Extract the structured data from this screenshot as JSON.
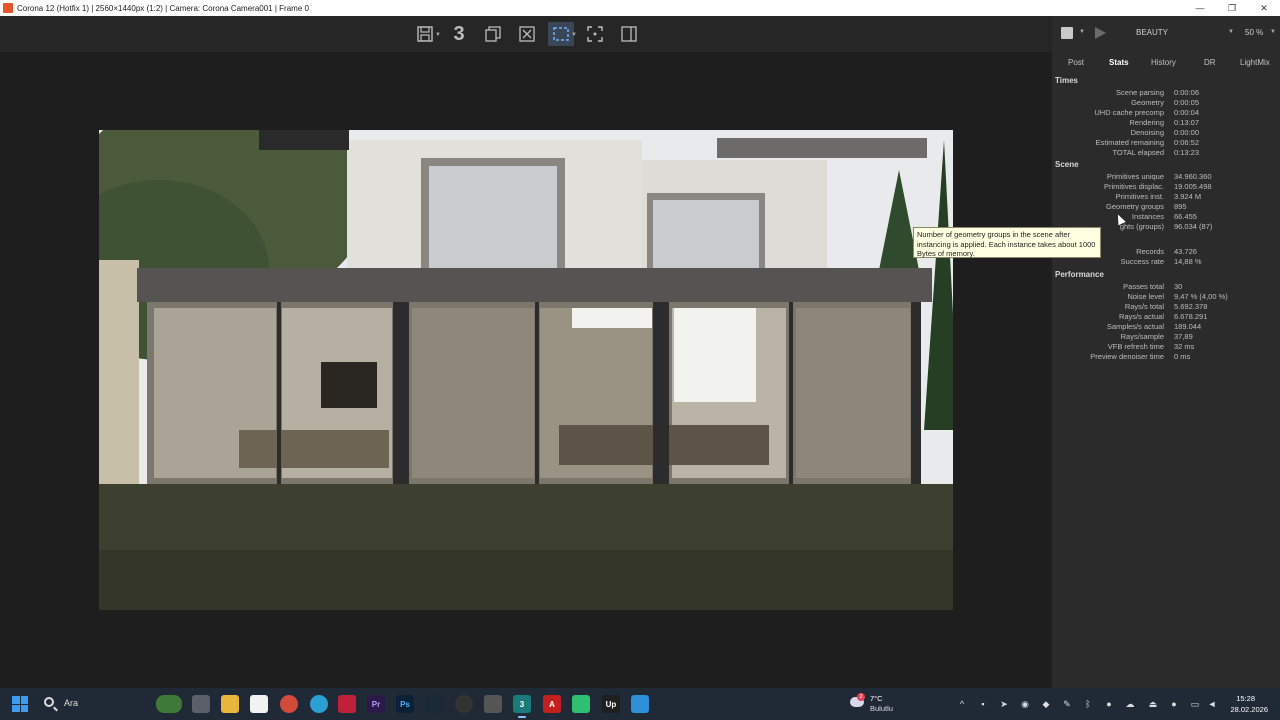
{
  "window": {
    "title": "Corona 12 (Hotfix 1) | 2560×1440px (1:2) | Camera: Corona Camera001 | Frame 0",
    "controls": [
      "minimize-icon",
      "maximize-icon",
      "close-icon"
    ]
  },
  "toolbar": {
    "buttons": [
      "save-icon",
      "3dsmax-icon",
      "copy-icon",
      "clear-icon",
      "region-select-icon",
      "fit-view-icon",
      "split-view-icon"
    ],
    "three_label": "3"
  },
  "panel": {
    "render_pass": "BEAUTY",
    "zoom": "50 %",
    "tabs": [
      "Post",
      "Stats",
      "History",
      "DR",
      "LightMix"
    ],
    "active_tab": "Stats",
    "sections": {
      "times": {
        "title": "Times",
        "rows": [
          {
            "k": "Scene parsing",
            "v": "0:00:06"
          },
          {
            "k": "Geometry",
            "v": "0:00:05"
          },
          {
            "k": "UHD cache precomp",
            "v": "0:00:04"
          },
          {
            "k": "Rendering",
            "v": "0:13:07"
          },
          {
            "k": "Denoising",
            "v": "0:00:00"
          },
          {
            "k": "Estimated remaining",
            "v": "0:06:52"
          },
          {
            "k": "TOTAL elapsed",
            "v": "0:13:23"
          }
        ]
      },
      "scene": {
        "title": "Scene",
        "rows": [
          {
            "k": "Primitives unique",
            "v": "34.960.360"
          },
          {
            "k": "Primitives displac.",
            "v": "19.005.498"
          },
          {
            "k": "Primitives inst.",
            "v": "3.924 M"
          },
          {
            "k": "Geometry groups",
            "v": "895"
          },
          {
            "k": "Instances",
            "v": "66.455"
          },
          {
            "k": "ghts (groups)",
            "v": "96.034 (87)"
          },
          {
            "k": "Records",
            "v": "43.726"
          },
          {
            "k": "Success rate",
            "v": "14,88 %"
          }
        ]
      },
      "performance": {
        "title": "Performance",
        "rows": [
          {
            "k": "Passes total",
            "v": "30"
          },
          {
            "k": "Noise level",
            "v": "9,47 % (4,00 %)"
          },
          {
            "k": "Rays/s total",
            "v": "5.692.378"
          },
          {
            "k": "Rays/s actual",
            "v": "6.678.291"
          },
          {
            "k": "Samples/s actual",
            "v": "189.044"
          },
          {
            "k": "Rays/sample",
            "v": "37,89"
          },
          {
            "k": "VFB refresh time",
            "v": "32 ms"
          },
          {
            "k": "Preview denoiser time",
            "v": "0 ms"
          }
        ]
      }
    },
    "tooltip": "Number of geometry groups in the scene after instancing is applied. Each instance takes about 1000 Bytes of memory."
  },
  "taskbar": {
    "search_placeholder": "Ara",
    "weather_temp": "7°C",
    "weather_desc": "Bulutlu",
    "weather_badge": "2",
    "time": "15:28",
    "date": "28.02.2026",
    "apps": [
      "widgets-icon",
      "task-view-icon",
      "file-explorer-icon",
      "notepad-icon",
      "chrome-icon",
      "telegram-icon",
      "app-red-icon",
      "premiere-icon",
      "photoshop-icon",
      "steam-icon",
      "obs-icon",
      "calculator-icon",
      "3dsmax-app-icon",
      "acrobat-icon",
      "game-icon",
      "upwork-icon",
      "photos-icon"
    ],
    "colors": {
      "accent": "#3d9cf0",
      "bg": "#202a36"
    }
  }
}
